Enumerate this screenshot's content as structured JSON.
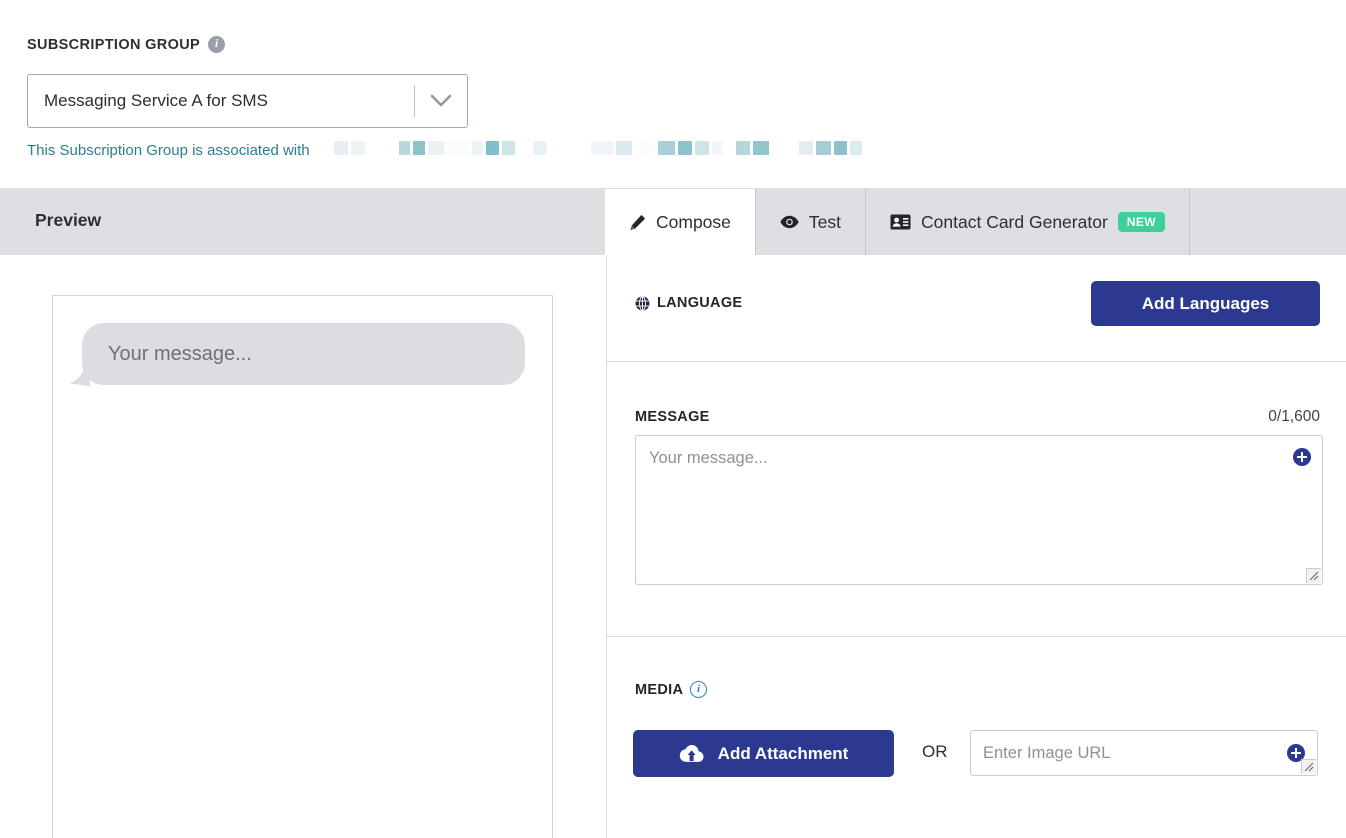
{
  "subscription": {
    "label": "SUBSCRIPTION GROUP",
    "info_icon": "info-circle-icon",
    "selected_value": "Messaging Service A for SMS",
    "chevron_icon": "chevron-down-icon",
    "note_text": "This Subscription Group is associated with",
    "note_redacted": true,
    "note_color": "#2b7f8d"
  },
  "preview": {
    "header_title": "Preview",
    "bubble_placeholder": "Your message...",
    "header_bg": "#dedfe3",
    "bubble_bg": "#dcdde1"
  },
  "tabs": [
    {
      "label": "Compose",
      "icon": "pencil-icon",
      "active": true,
      "badge": null
    },
    {
      "label": "Test",
      "icon": "eye-icon",
      "active": false,
      "badge": null
    },
    {
      "label": "Contact Card Generator",
      "icon": "contact-card-icon",
      "active": false,
      "badge": "NEW"
    }
  ],
  "language": {
    "label": "LANGUAGE",
    "icon": "globe-icon",
    "add_button_label": "Add Languages"
  },
  "message": {
    "label": "MESSAGE",
    "counter": "0/1,600",
    "placeholder": "Your message...",
    "add_icon": "plus-circle-icon",
    "resize_handle": "resize-grip-icon"
  },
  "media": {
    "label": "MEDIA",
    "info_icon": "info-circle-icon",
    "attachment_button_label": "Add Attachment",
    "attachment_icon": "cloud-upload-icon",
    "or_label": "OR",
    "url_placeholder": "Enter Image URL",
    "add_icon": "plus-circle-icon",
    "resize_handle": "resize-grip-icon"
  },
  "colors": {
    "primary_blue": "#2b3990",
    "badge_green": "#3ecf9a",
    "teal_link": "#2b7f8d",
    "header_gray": "#dedfe3",
    "info_blue": "#2f7fd0"
  }
}
